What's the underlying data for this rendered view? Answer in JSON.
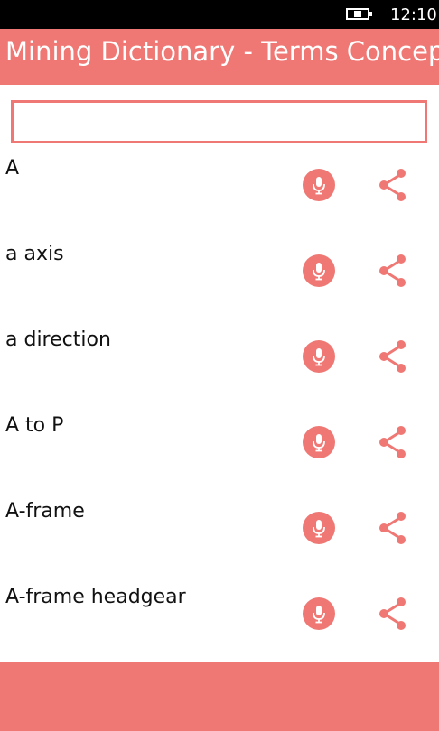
{
  "status_bar": {
    "time": "12:10"
  },
  "header": {
    "title": "Mining Dictionary - Terms Concepts"
  },
  "search": {
    "value": "",
    "placeholder": ""
  },
  "terms": [
    {
      "label": "A"
    },
    {
      "label": "a axis"
    },
    {
      "label": "a direction"
    },
    {
      "label": "A to P"
    },
    {
      "label": "A-frame"
    },
    {
      "label": "A-frame headgear"
    }
  ],
  "icons": {
    "speak": "microphone-icon",
    "share": "share-icon"
  },
  "colors": {
    "accent": "#f07874",
    "status_bar": "#000000",
    "text": "#111111"
  }
}
